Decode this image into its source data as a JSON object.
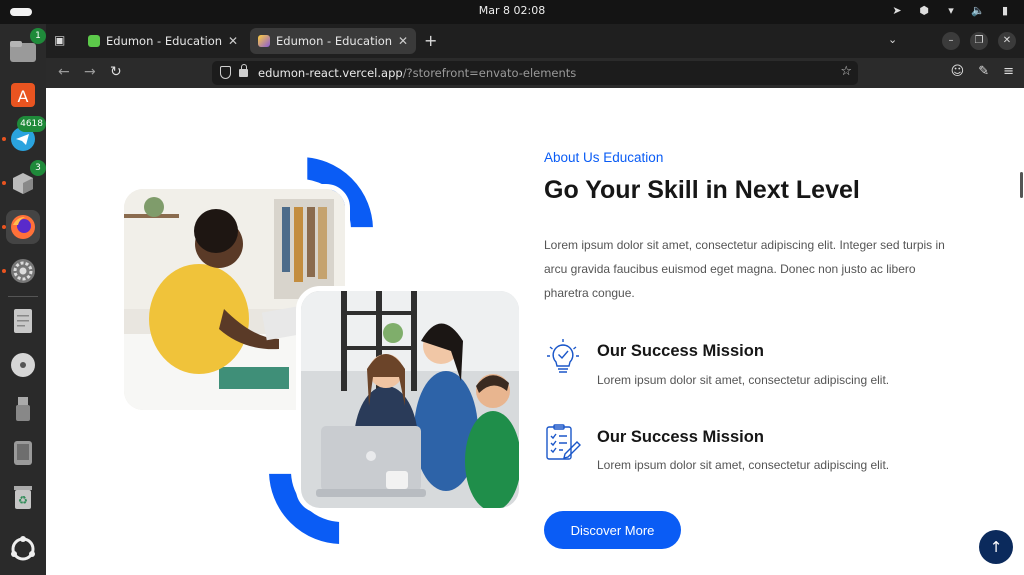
{
  "system": {
    "clock": "Mar 8  02:08",
    "dock_badges": {
      "files": "1",
      "telegram": "4618",
      "packages": "3"
    }
  },
  "browser": {
    "tabs": [
      {
        "title": "Edumon - Education & Or",
        "favicon_color": "#5cc94a"
      },
      {
        "title": "Edumon - Education Reac",
        "favicon_color": "#8a5bd6"
      }
    ],
    "url_host": "edumon-react.vercel.app",
    "url_path": "/?storefront=envato-elements"
  },
  "about": {
    "eyebrow": "About Us Education",
    "heading": "Go Your Skill in Next Level",
    "description": "Lorem ipsum dolor sit amet, consectetur adipiscing elit. Integer sed turpis in arcu gravida faucibus euismod eget magna. Donec non justo ac libero pharetra congue.",
    "features": [
      {
        "icon": "lightbulb-check-icon",
        "title": "Our Success Mission",
        "text": "Lorem ipsum dolor sit amet, consectetur adipiscing elit."
      },
      {
        "icon": "checklist-pencil-icon",
        "title": "Our Success Mission",
        "text": "Lorem ipsum dolor sit amet, consectetur adipiscing elit."
      }
    ],
    "cta_label": "Discover More"
  },
  "colors": {
    "accent": "#0a5cf5",
    "dark": "#0b2a5c"
  }
}
